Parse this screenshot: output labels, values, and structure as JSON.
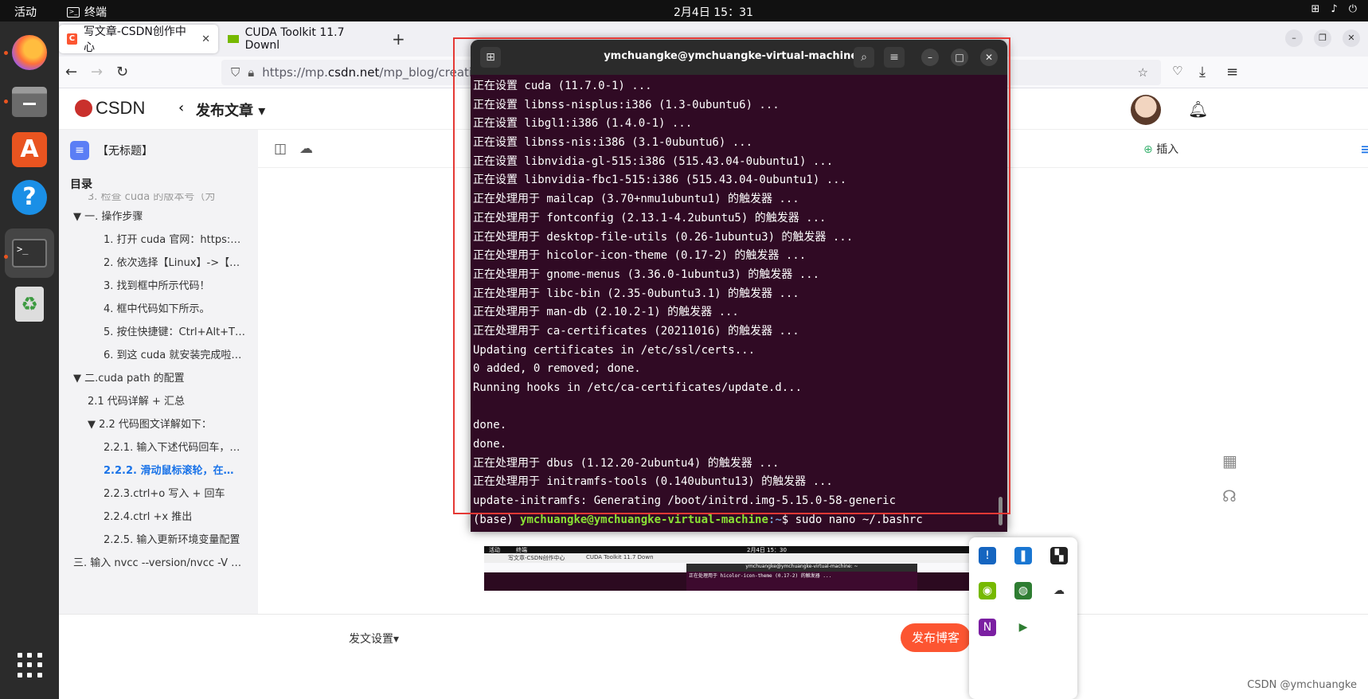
{
  "topbar": {
    "activities": "活动",
    "app_name": "终端",
    "clock": "2月4日  15：31",
    "tray_network": "⊞",
    "tray_volume": "♪",
    "tray_power": "⏻"
  },
  "browser": {
    "tabs": [
      {
        "label": "写文章-CSDN创作中心"
      },
      {
        "label": "CUDA Toolkit 11.7 Downl"
      }
    ],
    "url_prefix": "https://mp.",
    "url_domain": "csdn.net",
    "url_rest": "/mp_blog/creatio"
  },
  "csdn": {
    "logo": "CSDN",
    "page_title": "发布文章",
    "doc_title": "【无标题】",
    "toc_title": "目录",
    "toc": [
      {
        "label": "3. 检查 cuda 的版本号（为",
        "indent": 2
      },
      {
        "label": "▼ 一. 操作步骤",
        "indent": 1
      },
      {
        "label": "1. 打开 cuda 官网：https:…",
        "indent": 3
      },
      {
        "label": "2. 依次选择【Linux】->【…",
        "indent": 3
      },
      {
        "label": "3. 找到框中所示代码！",
        "indent": 3
      },
      {
        "label": "4. 框中代码如下所示。",
        "indent": 3
      },
      {
        "label": "5. 按住快捷键：Ctrl+Alt+T…",
        "indent": 3
      },
      {
        "label": "6. 到这 cuda 就安装完成啦…",
        "indent": 3
      },
      {
        "label": "▼ 二.cuda path 的配置",
        "indent": 1
      },
      {
        "label": "2.1 代码详解 + 汇总",
        "indent": 2
      },
      {
        "label": "▼ 2.2 代码图文详解如下：",
        "indent": 2
      },
      {
        "label": "2.2.1. 输入下述代码回车，…",
        "indent": 3
      },
      {
        "label": "2.2.2. 滑动鼠标滚轮，在…",
        "indent": 3,
        "active": true
      },
      {
        "label": "2.2.3.ctrl+o 写入 + 回车",
        "indent": 3
      },
      {
        "label": "2.2.4.ctrl +x 推出",
        "indent": 3
      },
      {
        "label": "2.2.5. 输入更新环境变量配置",
        "indent": 3
      },
      {
        "label": "三. 输入 nvcc --version/nvcc -V …",
        "indent": 1
      }
    ],
    "insert_label": "插入",
    "publish_settings": "发文设置",
    "publish_button": "发布博客"
  },
  "terminal": {
    "title": "ymchuangke@ymchuangke-virtual-machine: ~",
    "lines": [
      "正在设置 cuda (11.7.0-1) ...",
      "正在设置 libnss-nisplus:i386 (1.3-0ubuntu6) ...",
      "正在设置 libgl1:i386 (1.4.0-1) ...",
      "正在设置 libnss-nis:i386 (3.1-0ubuntu6) ...",
      "正在设置 libnvidia-gl-515:i386 (515.43.04-0ubuntu1) ...",
      "正在设置 libnvidia-fbc1-515:i386 (515.43.04-0ubuntu1) ...",
      "正在处理用于 mailcap (3.70+nmu1ubuntu1) 的触发器 ...",
      "正在处理用于 fontconfig (2.13.1-4.2ubuntu5) 的触发器 ...",
      "正在处理用于 desktop-file-utils (0.26-1ubuntu3) 的触发器 ...",
      "正在处理用于 hicolor-icon-theme (0.17-2) 的触发器 ...",
      "正在处理用于 gnome-menus (3.36.0-1ubuntu3) 的触发器 ...",
      "正在处理用于 libc-bin (2.35-0ubuntu3.1) 的触发器 ...",
      "正在处理用于 man-db (2.10.2-1) 的触发器 ...",
      "正在处理用于 ca-certificates (20211016) 的触发器 ...",
      "Updating certificates in /etc/ssl/certs...",
      "0 added, 0 removed; done.",
      "Running hooks in /etc/ca-certificates/update.d...",
      "",
      "done.",
      "done.",
      "正在处理用于 dbus (1.12.20-2ubuntu4) 的触发器 ...",
      "正在处理用于 initramfs-tools (0.140ubuntu13) 的触发器 ...",
      "update-initramfs: Generating /boot/initrd.img-5.15.0-58-generic"
    ],
    "prompt_env": "(base) ",
    "prompt_user": "ymchuangke@ymchuangke-virtual-machine",
    "prompt_path": ":~",
    "prompt_cmd": "$ sudo nano ~/.bashrc"
  },
  "thumbnail": {
    "top_activities": "活动",
    "top_app": "终端",
    "top_clock": "2月4日  15：30",
    "tab1": "写文章-CSDN创作中心",
    "tab2": "CUDA Toolkit 11.7 Down",
    "term_title": "ymchuangke@ymchuangke-virtual-machine: ~",
    "term_line": "正在处理用于 hicolor-icon-theme (0.17-2) 的触发器 ..."
  },
  "watermark": "CSDN @ymchuangke"
}
